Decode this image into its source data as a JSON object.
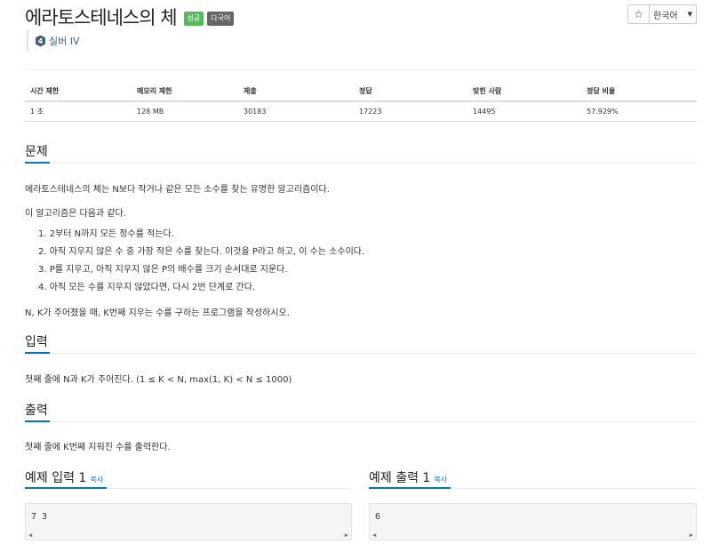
{
  "header": {
    "title": "에라토스테네스의 체",
    "badges": [
      "성공",
      "다국어"
    ],
    "star_icon": "star-icon",
    "language_label": "한국어",
    "tier_label": "실버 IV",
    "tier_number": "4"
  },
  "info_table": {
    "headers": [
      "시간 제한",
      "메모리 제한",
      "제출",
      "정답",
      "맞힌 사람",
      "정답 비율"
    ],
    "values": [
      "1 초",
      "128 MB",
      "30183",
      "17223",
      "14495",
      "57.929%"
    ]
  },
  "problem": {
    "title": "문제",
    "intro": "에라토스테네스의 체는 N보다 작거나 같은 모든 소수를 찾는 유명한 알고리즘이다.",
    "subintro": "이 알고리즘은 다음과 같다.",
    "steps": [
      "1. 2부터 N까지 모든 정수를 적는다.",
      "2. 아직 지우지 않은 수 중 가장 작은 수를 찾는다. 이것을 P라고 하고, 이 수는 소수이다.",
      "3. P를 지우고, 아직 지우지 않은 P의 배수를 크기 순서대로 지운다.",
      "4. 아직 모든 수를 지우지 않았다면, 다시 2번 단계로 간다."
    ],
    "task": "N, K가 주어졌을 때, K번째 지우는 수를 구하는 프로그램을 작성하시오."
  },
  "input": {
    "title": "입력",
    "text": "첫째 줄에 N과 K가 주어진다. (1 ≤ K < N, max(1, K) < N ≤ 1000)"
  },
  "output": {
    "title": "출력",
    "text": "첫째 줄에 K번째 지워진 수를 출력한다."
  },
  "samples": {
    "input_title": "예제 입력 1",
    "output_title": "예제 출력 1",
    "copy_label": "복사",
    "input_value": "7 3",
    "output_value": "6"
  },
  "colors": {
    "accent": "#0076c0",
    "success": "#5cb85c",
    "tier": "#435f7a"
  }
}
